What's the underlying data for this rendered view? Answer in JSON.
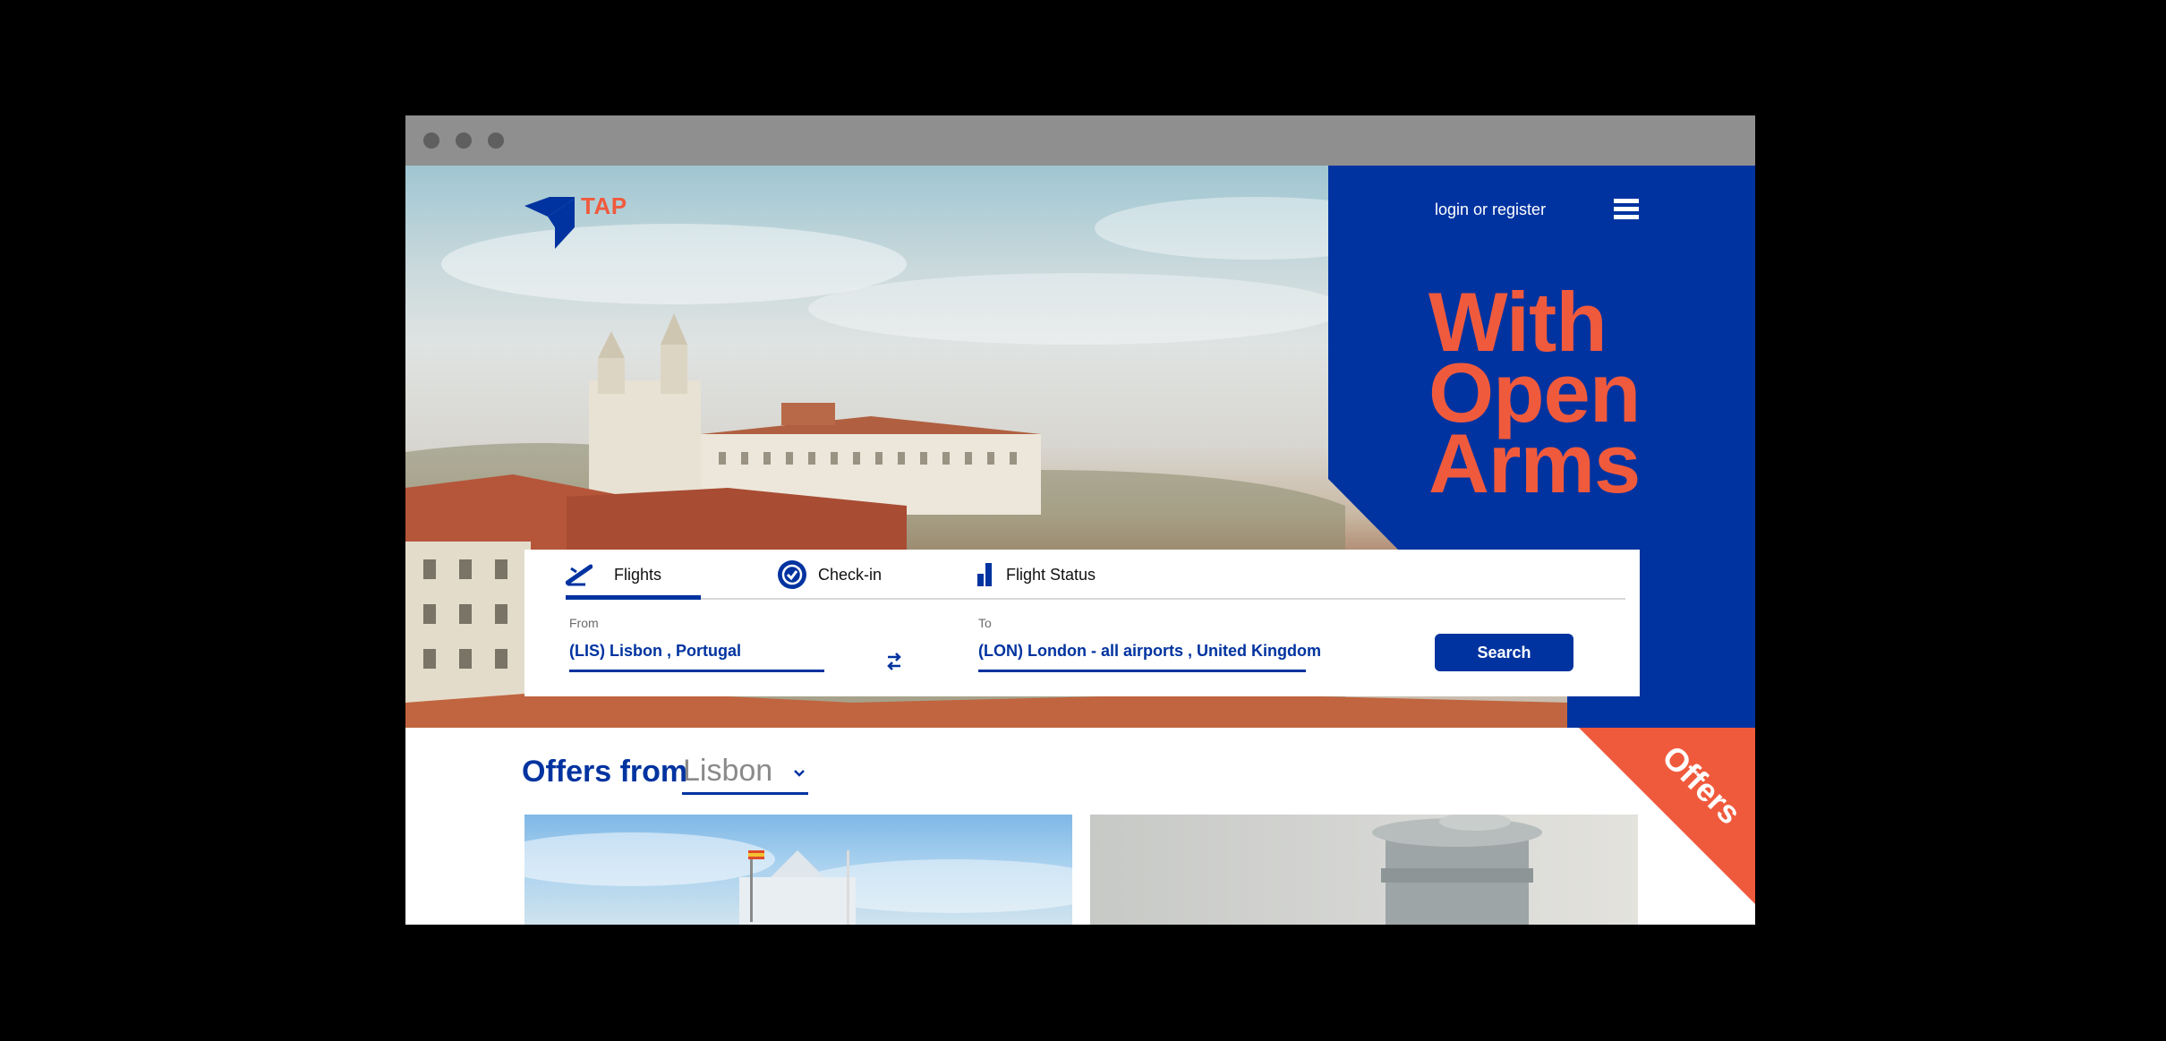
{
  "header": {
    "logo_text": "TAP",
    "login_label": "login or register"
  },
  "hero": {
    "headline_line1": "With",
    "headline_line2": "Open",
    "headline_line3": "Arms"
  },
  "search": {
    "tabs": [
      {
        "label": "Flights",
        "icon": "plane-takeoff-icon"
      },
      {
        "label": "Check-in",
        "icon": "check-circle-icon"
      },
      {
        "label": "Flight Status",
        "icon": "status-bars-icon"
      }
    ],
    "from_label": "From",
    "from_value": "(LIS) Lisbon , Portugal",
    "to_label": "To",
    "to_value": "(LON) London -  all airports , United Kingdom",
    "search_button": "Search"
  },
  "offers": {
    "title": "Offers from",
    "city": "Lisbon",
    "corner_label": "Offers"
  },
  "colors": {
    "brand_blue": "#0033a0",
    "accent_orange": "#f05a3c"
  }
}
